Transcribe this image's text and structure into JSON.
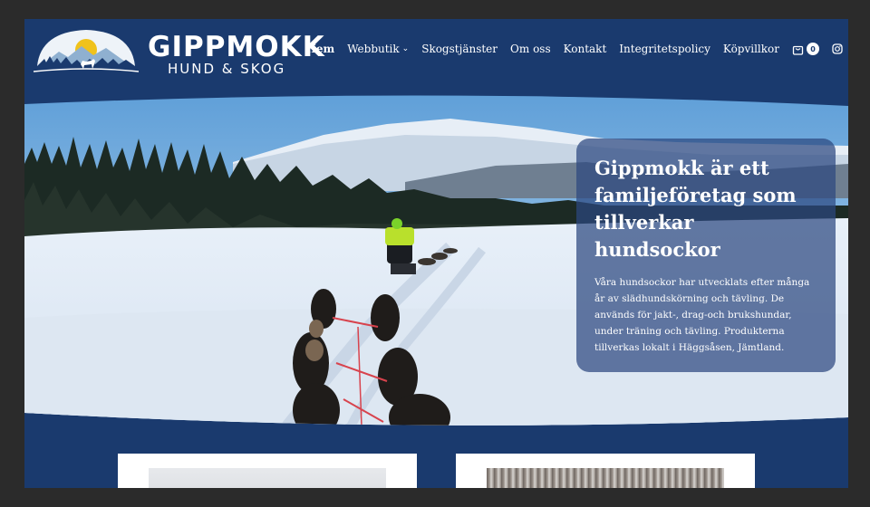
{
  "brand": {
    "title": "GIPPMOKK",
    "subtitle": "HUND & SKOG"
  },
  "nav": {
    "items": [
      {
        "label": "Hem",
        "active": true
      },
      {
        "label": "Webbutik",
        "dropdown": true
      },
      {
        "label": "Skogstjänster"
      },
      {
        "label": "Om oss"
      },
      {
        "label": "Kontakt"
      },
      {
        "label": "Integritetspolicy"
      },
      {
        "label": "Köpvillkor"
      }
    ],
    "cart_count": "0",
    "cart_icon": "shopping-bag-icon",
    "social_icon": "instagram-icon"
  },
  "hero": {
    "heading": "Gippmokk är ett familjeföretag som tillverkar hundsockor",
    "body": "Våra hundsockor har utvecklats efter många år av slädhundskörning och tävling. De används för jakt-, drag-och brukshundar, under träning och tävling. Produkterna tillverkas lokalt i Häggsåsen, Jämtland."
  },
  "colors": {
    "brand_blue": "#1a3a6e",
    "page_bg": "#2b2b2b",
    "logo_sun": "#f0c21b"
  }
}
